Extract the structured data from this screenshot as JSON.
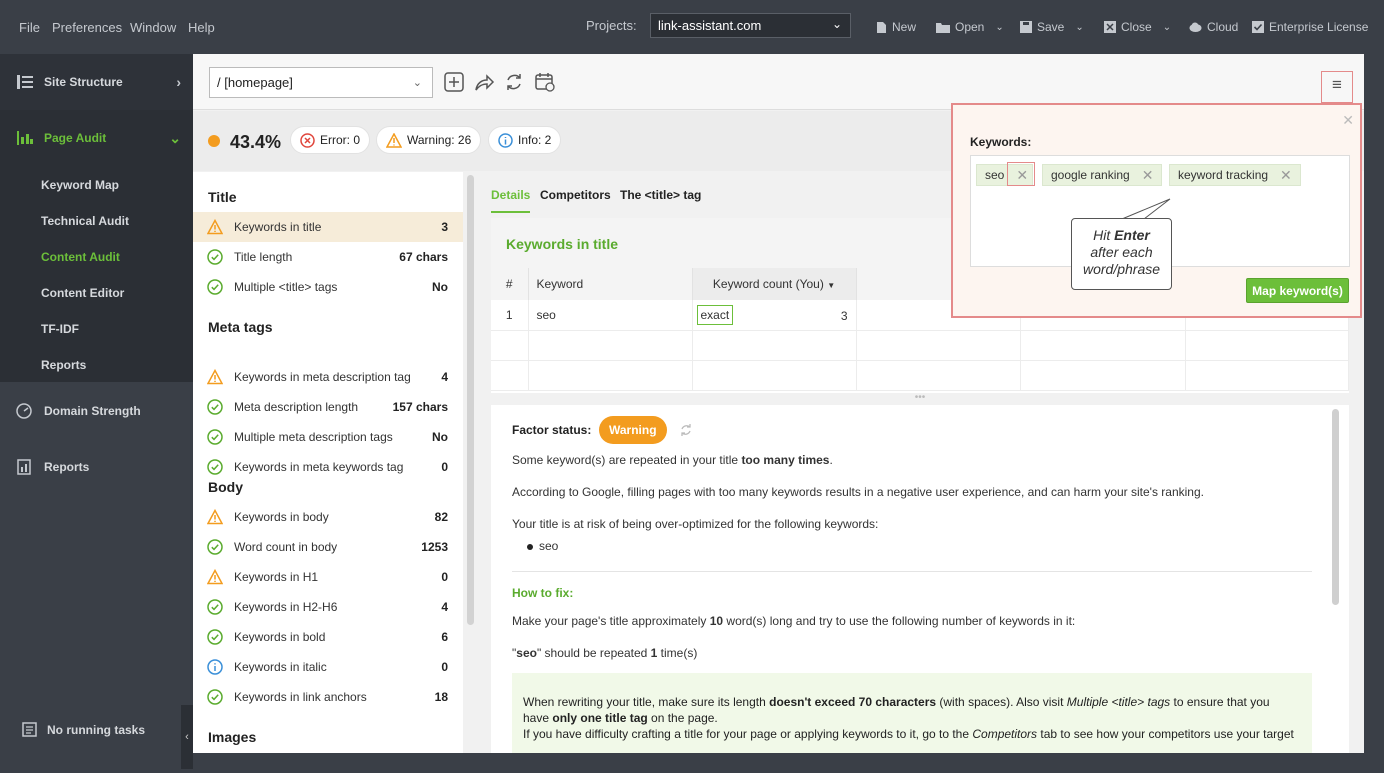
{
  "menubar": {
    "file": "File",
    "preferences": "Preferences",
    "window": "Window",
    "help": "Help"
  },
  "projects": {
    "label": "Projects:",
    "selected": "link-assistant.com"
  },
  "toolbar": {
    "new": "New",
    "open": "Open",
    "save": "Save",
    "close": "Close",
    "cloud": "Cloud",
    "license": "Enterprise License"
  },
  "sidebar": {
    "site_structure": "Site Structure",
    "page_audit": "Page Audit",
    "sub": [
      "Keyword Map",
      "Technical Audit",
      "Content Audit",
      "Content Editor",
      "TF-IDF",
      "Reports"
    ],
    "domain_strength": "Domain Strength",
    "reports": "Reports",
    "tasks": "No running tasks"
  },
  "page": {
    "url": "/ [homepage]"
  },
  "status": {
    "score": "43.4%",
    "error": "Error: 0",
    "warning": "Warning: 26",
    "info": "Info: 2"
  },
  "colors": {
    "accent": "#6cbf3a",
    "warning": "#f39c1f",
    "error": "#e0463c",
    "info": "#3a8fd8",
    "sidebar": "#3a3f47"
  },
  "factors": {
    "title_section": "Title",
    "meta_section": "Meta tags",
    "body_section": "Body",
    "images_section": "Images",
    "items": [
      {
        "label": "Keywords in title",
        "value": "3",
        "status": "warning"
      },
      {
        "label": "Title length",
        "value": "67 chars",
        "status": "ok"
      },
      {
        "label": "Multiple <title> tags",
        "value": "No",
        "status": "ok"
      },
      {
        "label": "Keywords in meta description tag",
        "value": "4",
        "status": "warning"
      },
      {
        "label": "Meta description length",
        "value": "157 chars",
        "status": "ok"
      },
      {
        "label": "Multiple meta description tags",
        "value": "No",
        "status": "ok"
      },
      {
        "label": "Keywords in meta keywords tag",
        "value": "0",
        "status": "ok"
      },
      {
        "label": "Keywords in body",
        "value": "82",
        "status": "warning"
      },
      {
        "label": "Word count in body",
        "value": "1253",
        "status": "ok"
      },
      {
        "label": "Keywords in H1",
        "value": "0",
        "status": "warning"
      },
      {
        "label": "Keywords in H2-H6",
        "value": "4",
        "status": "ok"
      },
      {
        "label": "Keywords in bold",
        "value": "6",
        "status": "ok"
      },
      {
        "label": "Keywords in italic",
        "value": "0",
        "status": "info"
      },
      {
        "label": "Keywords in link anchors",
        "value": "18",
        "status": "ok"
      }
    ]
  },
  "details": {
    "tabs": [
      "Details",
      "Competitors",
      "The <title> tag"
    ],
    "table_title": "Keywords in title",
    "columns": [
      "#",
      "Keyword",
      "Keyword count (You)"
    ],
    "rows": [
      {
        "n": "1",
        "keyword": "seo",
        "match": "exact",
        "count": "3"
      }
    ]
  },
  "desc": {
    "factor_status_label": "Factor status:",
    "factor_status": "Warning",
    "p1_a": "Some keyword(s) are repeated in your title ",
    "p1_b": "too many times",
    "p1_c": ".",
    "p2": "According to Google, filling pages with too many keywords results in a negative user experience, and can harm your site's ranking.",
    "p3": "Your title is at risk of being over-optimized for the following keywords:",
    "bullet": "seo",
    "how_to_fix": "How to fix:",
    "fix1_a": "Make your page's title approximately ",
    "fix1_b": "10",
    "fix1_c": " word(s) long and try to use the following number of keywords in it:",
    "fix2_a": "\"",
    "fix2_b": "seo",
    "fix2_c": "\" should be repeated ",
    "fix2_d": "1",
    "fix2_e": " time(s)",
    "tip_a": "When rewriting your title, make sure its length ",
    "tip_b": "doesn't exceed 70 characters",
    "tip_c": " (with spaces). Also visit ",
    "tip_d": "Multiple <title> tags",
    "tip_e": " to ensure that you",
    "tip_f": "have ",
    "tip_g": "only one title tag",
    "tip_h": " on the page.",
    "tip_i": "If you have difficulty crafting a title for your page or applying keywords to it, go to the ",
    "tip_j": "Competitors",
    "tip_k": " tab to see how your competitors use your target"
  },
  "keywords_popup": {
    "label": "Keywords:",
    "chips": [
      "seo",
      "google ranking",
      "keyword tracking"
    ],
    "map_button": "Map keyword(s)",
    "hint_a": "Hit ",
    "hint_b": "Enter",
    "hint_c": "after each",
    "hint_d": "word/phrase"
  }
}
